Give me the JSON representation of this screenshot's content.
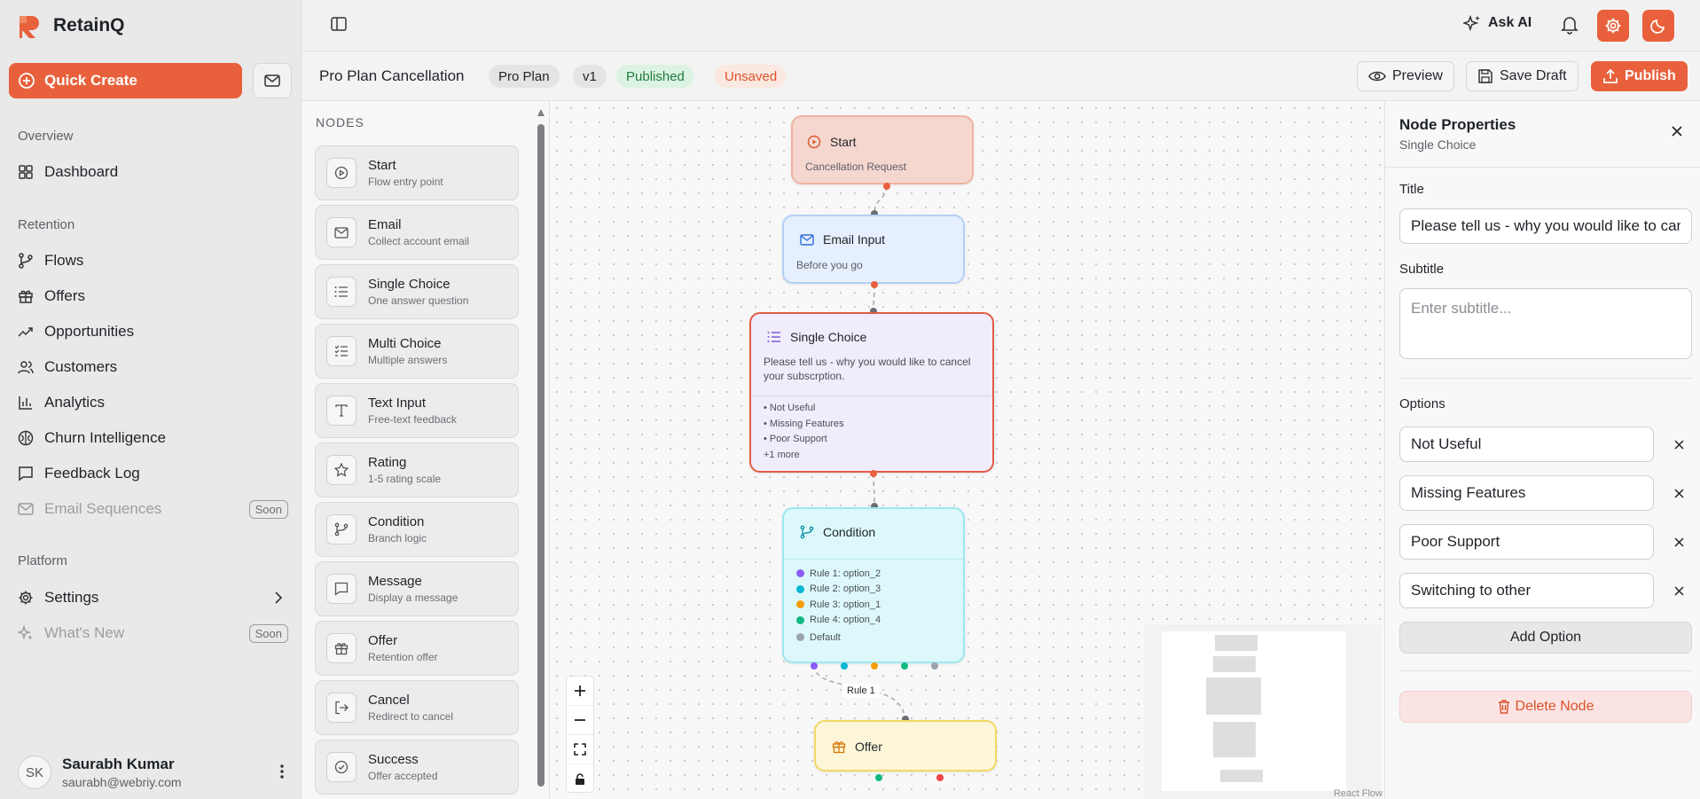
{
  "app": {
    "name": "RetainQ"
  },
  "sidebar": {
    "quick_create": "Quick Create",
    "sections": {
      "overview": "Overview",
      "retention": "Retention",
      "platform": "Platform"
    },
    "items": [
      {
        "label": "Dashboard",
        "icon": "dashboard-icon"
      },
      {
        "label": "Flows",
        "icon": "flows-icon"
      },
      {
        "label": "Offers",
        "icon": "gift-icon"
      },
      {
        "label": "Opportunities",
        "icon": "trend-icon"
      },
      {
        "label": "Customers",
        "icon": "users-icon"
      },
      {
        "label": "Analytics",
        "icon": "bar-chart-icon"
      },
      {
        "label": "Churn Intelligence",
        "icon": "brain-icon"
      },
      {
        "label": "Feedback Log",
        "icon": "message-icon"
      },
      {
        "label": "Email Sequences",
        "icon": "mail-icon",
        "badge": "Soon"
      },
      {
        "label": "Settings",
        "icon": "gear-icon"
      },
      {
        "label": "What's New",
        "icon": "sparkles-icon",
        "badge": "Soon"
      }
    ],
    "user": {
      "initials": "SK",
      "name": "Saurabh Kumar",
      "email": "saurabh@webriy.com"
    }
  },
  "topbar": {
    "ask_ai": "Ask AI"
  },
  "flow": {
    "title": "Pro Plan Cancellation",
    "plan": "Pro Plan",
    "version": "v1",
    "status": "Published",
    "save_state": "Unsaved",
    "preview": "Preview",
    "save_draft": "Save Draft",
    "publish": "Publish"
  },
  "palette": {
    "title": "NODES",
    "items": [
      {
        "name": "Start",
        "desc": "Flow entry point",
        "icon": "play-icon"
      },
      {
        "name": "Email",
        "desc": "Collect account email",
        "icon": "mail-icon"
      },
      {
        "name": "Single Choice",
        "desc": "One answer question",
        "icon": "list-icon"
      },
      {
        "name": "Multi Choice",
        "desc": "Multiple answers",
        "icon": "checklist-icon"
      },
      {
        "name": "Text Input",
        "desc": "Free-text feedback",
        "icon": "text-icon"
      },
      {
        "name": "Rating",
        "desc": "1-5 rating scale",
        "icon": "star-icon"
      },
      {
        "name": "Condition",
        "desc": "Branch logic",
        "icon": "branch-icon"
      },
      {
        "name": "Message",
        "desc": "Display a message",
        "icon": "message-icon"
      },
      {
        "name": "Offer",
        "desc": "Retention offer",
        "icon": "gift-icon"
      },
      {
        "name": "Cancel",
        "desc": "Redirect to cancel",
        "icon": "exit-icon"
      },
      {
        "name": "Success",
        "desc": "Offer accepted",
        "icon": "check-circle-icon"
      }
    ]
  },
  "canvas": {
    "nodes": {
      "start": {
        "title": "Start",
        "sub": "Cancellation Request"
      },
      "email": {
        "title": "Email Input",
        "sub": "Before you go"
      },
      "single": {
        "title": "Single Choice",
        "question": "Please tell us - why you would like to cancel your subscrption.",
        "options": [
          "• Not Useful",
          "• Missing Features",
          "• Poor Support"
        ],
        "more": "+1 more"
      },
      "condition": {
        "title": "Condition",
        "rules": [
          {
            "label": "Rule 1: option_2",
            "color": "#8b5cf6"
          },
          {
            "label": "Rule 2: option_3",
            "color": "#06b6d4"
          },
          {
            "label": "Rule 3: option_1",
            "color": "#f59e0b"
          },
          {
            "label": "Rule 4: option_4",
            "color": "#10b981"
          },
          {
            "label": "Default",
            "color": "#9ca3af"
          }
        ]
      },
      "offer": {
        "title": "Offer"
      }
    },
    "edge_label": "Rule 1",
    "attribution": "React Flow"
  },
  "properties": {
    "title": "Node Properties",
    "subtitle": "Single Choice",
    "title_label": "Title",
    "title_value": "Please tell us - why you would like to cancel your subscrption.",
    "subtitle_label": "Subtitle",
    "subtitle_placeholder": "Enter subtitle...",
    "options_label": "Options",
    "options": [
      "Not Useful",
      "Missing Features",
      "Poor Support",
      "Switching to other"
    ],
    "add_option": "Add Option",
    "delete_node": "Delete Node"
  },
  "colors": {
    "accent": "#e8613c",
    "published": "#217a3c",
    "unsaved": "#d9532b"
  }
}
